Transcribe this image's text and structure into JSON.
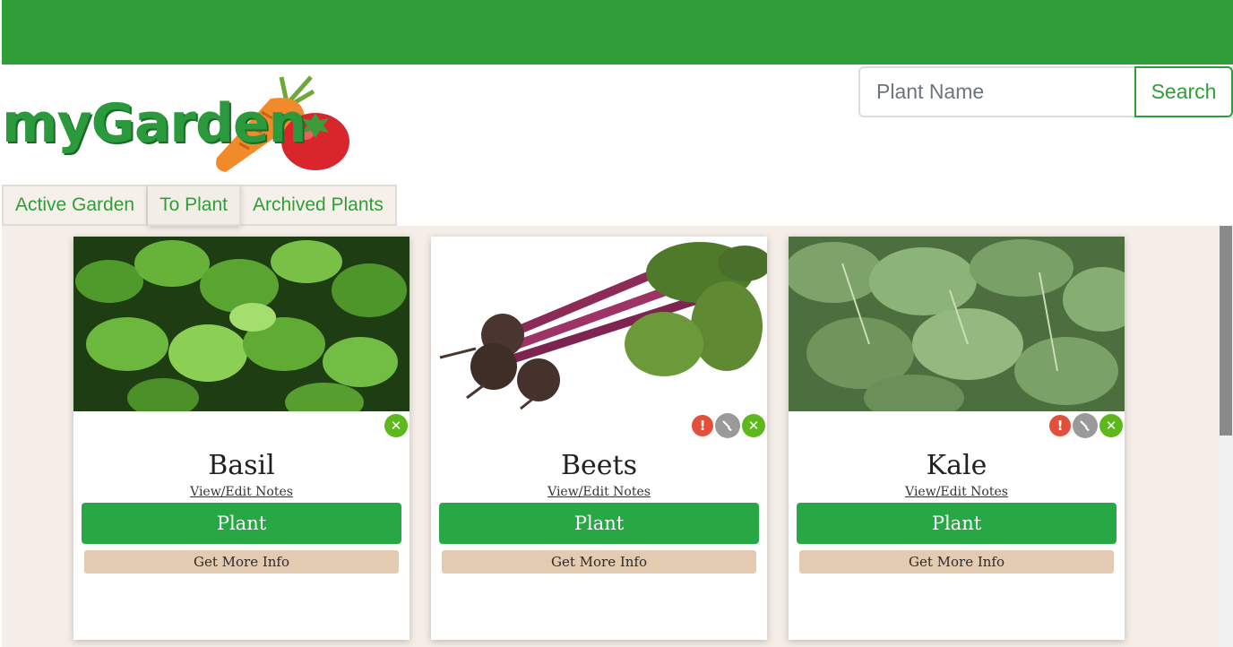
{
  "app": {
    "logo_text": "myGarden"
  },
  "search": {
    "placeholder": "Plant Name",
    "button_label": "Search"
  },
  "tabs": [
    {
      "label": "Active Garden"
    },
    {
      "label": "To Plant",
      "active": true
    },
    {
      "label": "Archived Plants"
    }
  ],
  "cards": [
    {
      "title": "Basil",
      "notes_link": "View/Edit Notes",
      "plant_label": "Plant",
      "info_label": "Get More Info",
      "icons": [
        "remove-icon"
      ]
    },
    {
      "title": "Beets",
      "notes_link": "View/Edit Notes",
      "plant_label": "Plant",
      "info_label": "Get More Info",
      "icons": [
        "alert-icon",
        "shovel-icon",
        "remove-icon"
      ]
    },
    {
      "title": "Kale",
      "notes_link": "View/Edit Notes",
      "plant_label": "Plant",
      "info_label": "Get More Info",
      "icons": [
        "alert-icon",
        "shovel-icon",
        "remove-icon"
      ]
    }
  ],
  "colors": {
    "brand_green": "#2f9e39",
    "button_green": "#28a745",
    "info_tan": "#e2cbb0",
    "background": "#f5eee8"
  }
}
